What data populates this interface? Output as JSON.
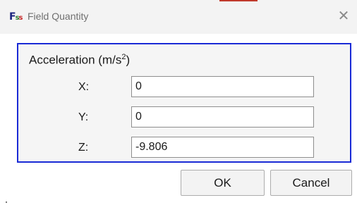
{
  "window": {
    "title": "Field Quantity",
    "icon": "app-icon",
    "close_glyph": "✕"
  },
  "group": {
    "title_prefix": "Acceleration (m/s",
    "title_sup": "2",
    "title_suffix": ")"
  },
  "fields": [
    {
      "label": "X:",
      "value": "0"
    },
    {
      "label": "Y:",
      "value": "0"
    },
    {
      "label": "Z:",
      "value": "-9.806"
    }
  ],
  "buttons": {
    "ok": "OK",
    "cancel": "Cancel"
  },
  "colors": {
    "group_border": "#1a2bd6",
    "titlebar_bg": "#f3f3f3"
  }
}
